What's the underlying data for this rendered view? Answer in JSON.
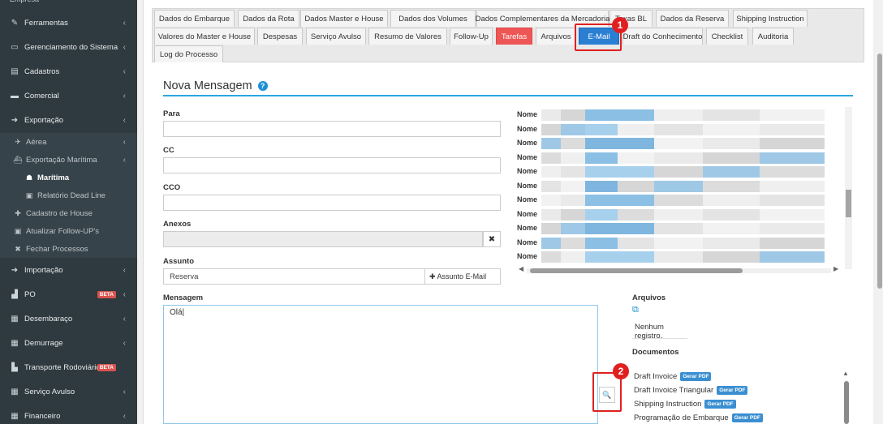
{
  "sidebar": {
    "items": [
      {
        "label": "Ferramentas",
        "icon": "wrench-icon",
        "glyph": "✎"
      },
      {
        "label": "Gerenciamento do Sistema",
        "icon": "laptop-icon",
        "glyph": "▭"
      },
      {
        "label": "Cadastros",
        "icon": "book-icon",
        "glyph": "▤"
      },
      {
        "label": "Comercial",
        "icon": "briefcase-icon",
        "glyph": "▬"
      },
      {
        "label": "Exportação",
        "icon": "circle-arrow-right-icon",
        "glyph": "➜"
      }
    ],
    "sub_items": [
      {
        "label": "Aérea",
        "icon": "plane-icon",
        "glyph": "✈"
      },
      {
        "label": "Exportação Marítima",
        "icon": "ship-icon",
        "glyph": "⛴"
      },
      {
        "label": "Marítima",
        "icon": "captain-icon",
        "glyph": "☗"
      },
      {
        "label": "Relatório Dead Line",
        "icon": "id-card-icon",
        "glyph": "▣"
      },
      {
        "label": "Cadastro de House",
        "icon": "plus-icon",
        "glyph": "✚"
      },
      {
        "label": "Atualizar Follow-UP's",
        "icon": "id-card-icon",
        "glyph": "▣"
      },
      {
        "label": "Fechar Processos",
        "icon": "times-icon",
        "glyph": "✖"
      }
    ],
    "items_lower": [
      {
        "label": "Importação",
        "icon": "circle-arrow-right-icon",
        "glyph": "➜"
      },
      {
        "label": "PO",
        "icon": "bar-chart-icon",
        "glyph": "▟",
        "badge": "BETA"
      },
      {
        "label": "Desembaraço",
        "icon": "building-icon",
        "glyph": "▦"
      },
      {
        "label": "Demurrage",
        "icon": "building-icon",
        "glyph": "▦"
      },
      {
        "label": "Transporte Rodoviário",
        "icon": "bus-icon",
        "glyph": "▙",
        "badge": "BETA"
      },
      {
        "label": "Serviço Avulso",
        "icon": "building-icon",
        "glyph": "▦"
      },
      {
        "label": "Financeiro",
        "icon": "building-icon",
        "glyph": "▦"
      }
    ]
  },
  "tabs": {
    "row1": [
      "Dados do Embarque",
      "Dados da Rota",
      "Dados Master e House",
      "Dados dos Volumes",
      "Dados Complementares da Mercadoria",
      "Taxas BL",
      "Dados da Reserva",
      "Shipping Instruction"
    ],
    "row2": [
      "Valores do Master e House",
      "Despesas",
      "Serviço Avulso",
      "Resumo de Valores",
      "Follow-Up",
      "Tarefas",
      "Arquivos",
      "E-Mail",
      "Draft do Conhecimento",
      "Checklist",
      "Auditoria"
    ],
    "row3": [
      "Log do Processo"
    ],
    "active": "E-Mail"
  },
  "annotations": {
    "one": "1",
    "two": "2",
    "color": "#e02020"
  },
  "form": {
    "title": "Nova Mensagem",
    "help_glyph": "?",
    "para_label": "Para",
    "para_value": "",
    "cc_label": "CC",
    "cc_value": "",
    "cco_label": "CCO",
    "cco_value": "",
    "anexos_label": "Anexos",
    "anexos_clear": "✖",
    "assunto_label": "Assunto",
    "assunto_value": "Reserva",
    "assunto_button": "✚ Assunto E-Mail",
    "mensagem_label": "Mensagem",
    "mensagem_value": "Olá|",
    "search_glyph": "🔍"
  },
  "names": {
    "label": "Nome",
    "count": 11
  },
  "right": {
    "arquivos_label": "Arquivos",
    "empty_text": "Nenhum registro.",
    "documentos_label": "Documentos",
    "documents": [
      {
        "name": "Draft Invoice",
        "action": "Gerar PDF"
      },
      {
        "name": "Draft Invoice Triangular",
        "action": "Gerar PDF"
      },
      {
        "name": "Shipping Instruction",
        "action": "Gerar PDF"
      },
      {
        "name": "Programação de Embarque",
        "action": "Gerar PDF"
      }
    ]
  },
  "colors": {
    "accent": "#2a7fd3",
    "danger": "#ee5555",
    "sidebar": "#2f3a40"
  }
}
